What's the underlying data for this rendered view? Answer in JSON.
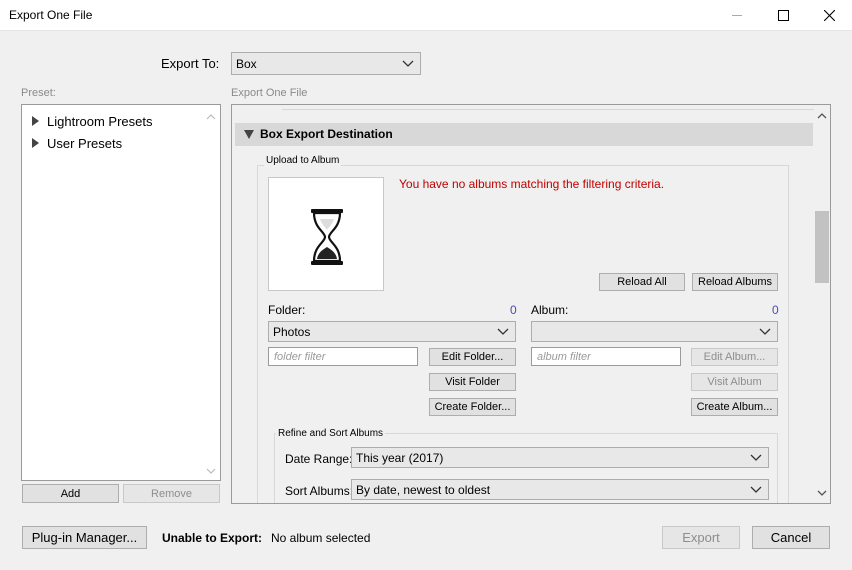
{
  "window": {
    "title": "Export One File",
    "minimize_icon": "minimize-icon",
    "maximize_icon": "maximize-icon",
    "close_icon": "close-icon"
  },
  "export_to": {
    "label": "Export To:",
    "value": "Box"
  },
  "preset": {
    "label": "Preset:",
    "items": [
      {
        "label": "Lightroom Presets"
      },
      {
        "label": "User Presets"
      }
    ],
    "add_label": "Add",
    "remove_label": "Remove"
  },
  "panel": {
    "label": "Export One File",
    "section_title": "Box Export Destination",
    "upload_group_title": "Upload to Album",
    "no_albums_message": "You have no albums matching the filtering criteria.",
    "reload_all_label": "Reload All",
    "reload_albums_label": "Reload Albums",
    "folder": {
      "label": "Folder:",
      "count": "0",
      "selected": "Photos",
      "filter_placeholder": "folder filter",
      "edit_label": "Edit Folder...",
      "visit_label": "Visit Folder",
      "create_label": "Create Folder..."
    },
    "album": {
      "label": "Album:",
      "count": "0",
      "selected": "",
      "filter_placeholder": "album filter",
      "edit_label": "Edit Album...",
      "visit_label": "Visit Album",
      "create_label": "Create Album..."
    },
    "refine": {
      "title": "Refine and Sort Albums",
      "date_range_label": "Date Range:",
      "date_range_value": "This year (2017)",
      "sort_label": "Sort Albums:",
      "sort_value": "By date, newest to oldest"
    }
  },
  "footer": {
    "plugin_manager_label": "Plug-in Manager...",
    "unable_label": "Unable to Export:",
    "status": "No album selected",
    "export_label": "Export",
    "cancel_label": "Cancel"
  },
  "colors": {
    "error_text": "#c00000",
    "count_text": "#4b4bb0",
    "section_header_bg": "#d8d8d8"
  }
}
